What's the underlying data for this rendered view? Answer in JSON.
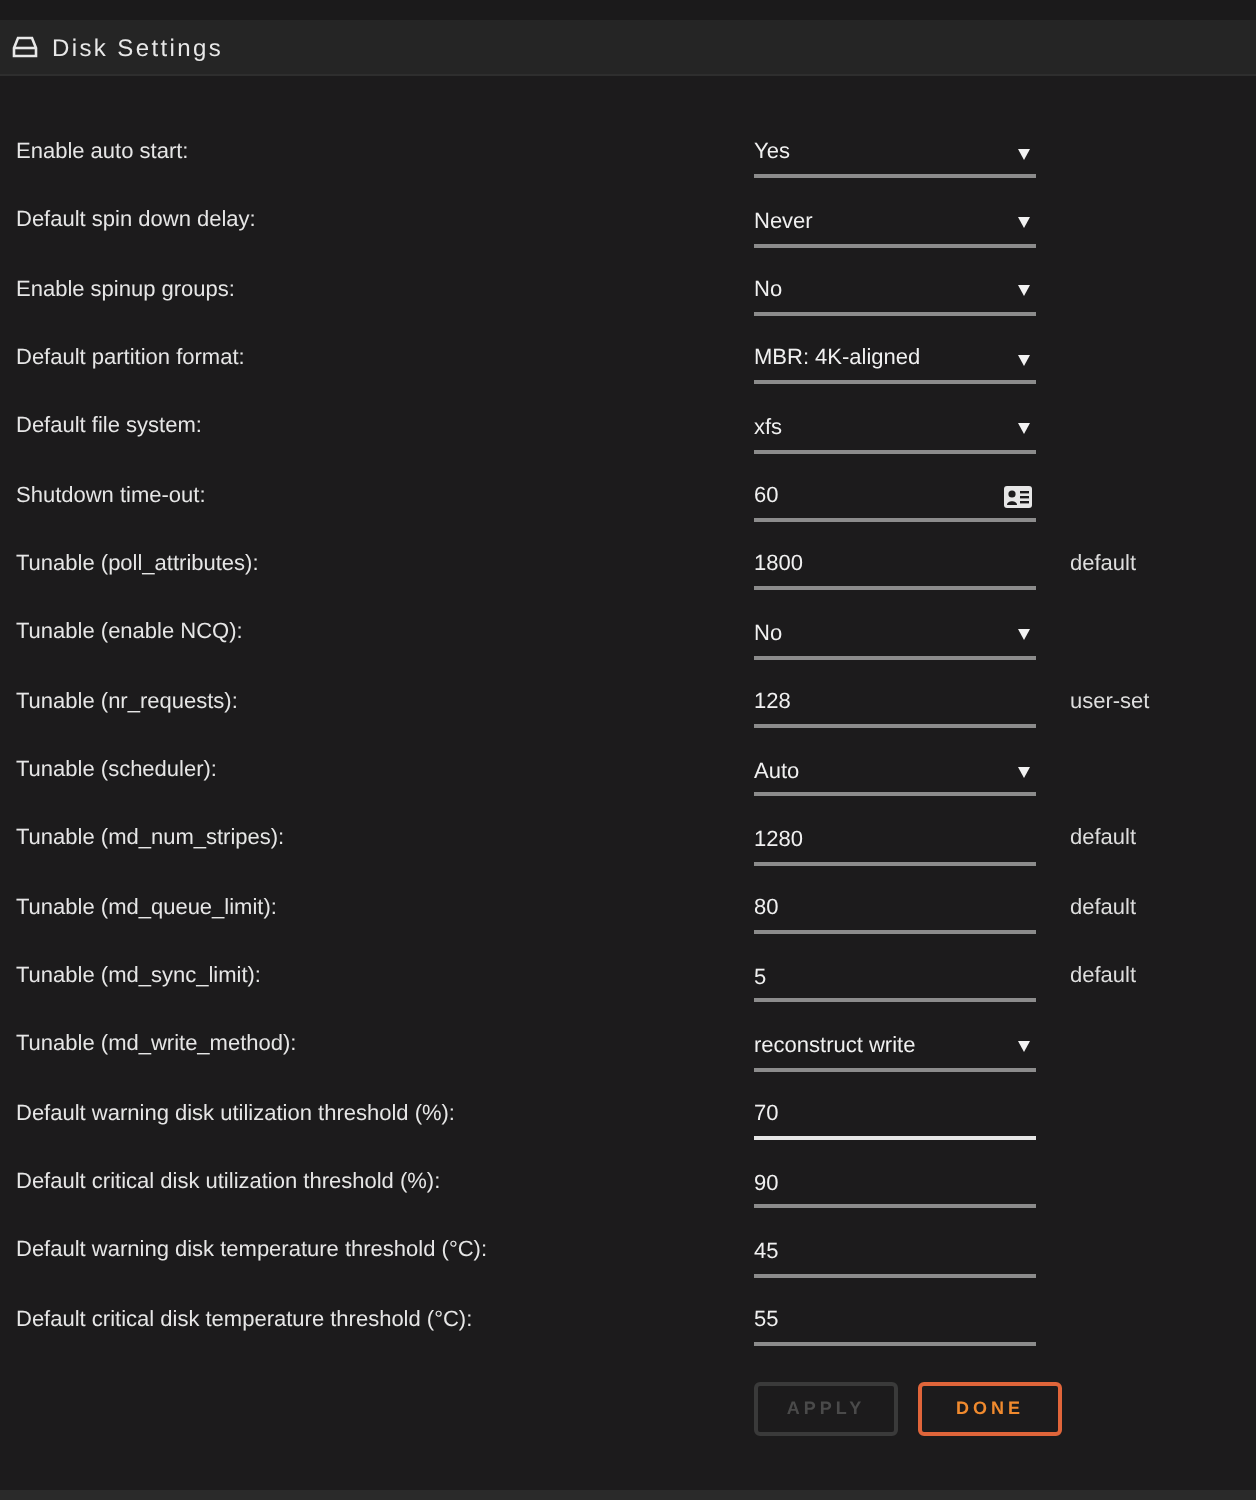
{
  "panel": {
    "title": "Disk Settings"
  },
  "settings": [
    {
      "label": "Enable auto start:",
      "kind": "select",
      "value": "Yes",
      "focused": false
    },
    {
      "label": "Default spin down delay:",
      "kind": "select",
      "value": "Never",
      "focused": false
    },
    {
      "label": "Enable spinup groups:",
      "kind": "select",
      "value": "No",
      "focused": false
    },
    {
      "label": "Default partition format:",
      "kind": "select",
      "value": "MBR: 4K-aligned",
      "focused": false
    },
    {
      "label": "Default file system:",
      "kind": "select",
      "value": "xfs",
      "focused": false
    },
    {
      "label": "Shutdown time-out:",
      "kind": "picker",
      "value": "60",
      "focused": false
    },
    {
      "label": "Tunable (poll_attributes):",
      "kind": "text",
      "value": "1800",
      "note": "default",
      "focused": false
    },
    {
      "label": "Tunable (enable NCQ):",
      "kind": "select",
      "value": "No",
      "focused": false
    },
    {
      "label": "Tunable (nr_requests):",
      "kind": "text",
      "value": "128",
      "note": "user-set",
      "focused": false
    },
    {
      "label": "Tunable (scheduler):",
      "kind": "select",
      "value": "Auto",
      "focused": false
    },
    {
      "label": "Tunable (md_num_stripes):",
      "kind": "text",
      "value": "1280",
      "note": "default",
      "focused": false
    },
    {
      "label": "Tunable (md_queue_limit):",
      "kind": "text",
      "value": "80",
      "note": "default",
      "focused": false
    },
    {
      "label": "Tunable (md_sync_limit):",
      "kind": "text",
      "value": "5",
      "note": "default",
      "focused": false
    },
    {
      "label": "Tunable (md_write_method):",
      "kind": "select",
      "value": "reconstruct write",
      "focused": false
    },
    {
      "label": "Default warning disk utilization threshold (%):",
      "kind": "text",
      "value": "70",
      "focused": true
    },
    {
      "label": "Default critical disk utilization threshold (%):",
      "kind": "text",
      "value": "90",
      "focused": false
    },
    {
      "label": "Default warning disk temperature threshold (°C):",
      "kind": "text",
      "value": "45",
      "focused": false
    },
    {
      "label": "Default critical disk temperature threshold (°C):",
      "kind": "text",
      "value": "55",
      "focused": false
    }
  ],
  "buttons": [
    {
      "label": "APPLY",
      "disabled": true
    },
    {
      "label": "DONE",
      "disabled": false
    }
  ]
}
